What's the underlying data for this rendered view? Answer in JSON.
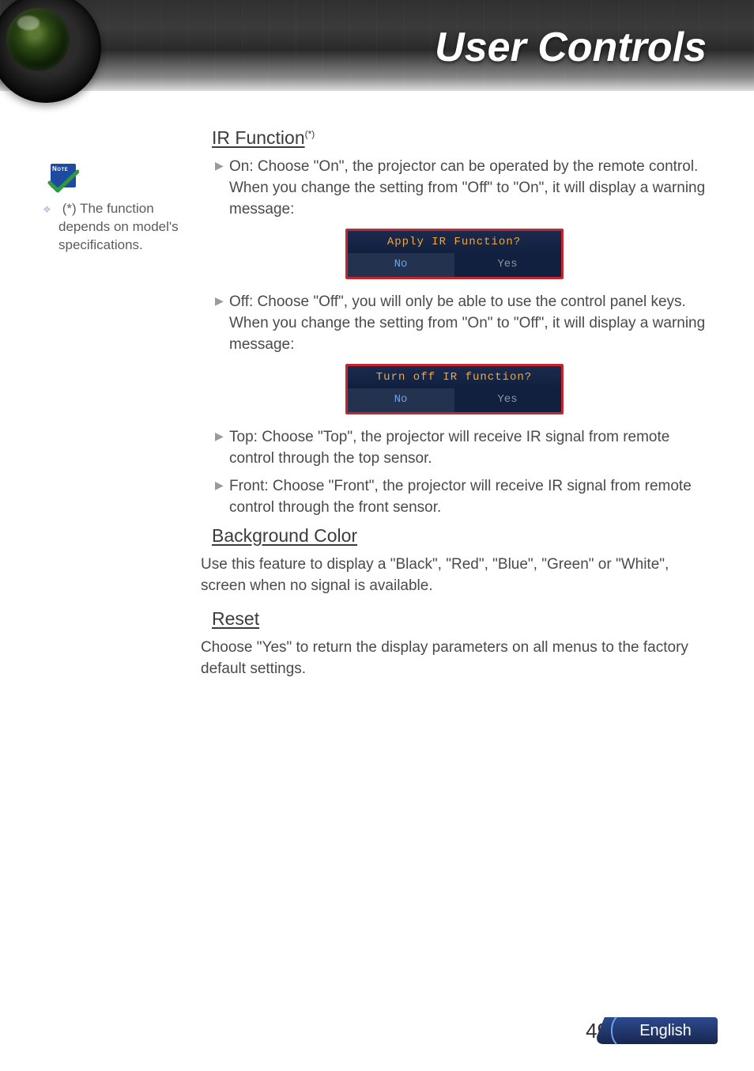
{
  "header": {
    "title": "User Controls"
  },
  "sidebar": {
    "note_badge": "Note",
    "note_text": "(*) The function depends on model's specifications."
  },
  "sections": {
    "ir": {
      "title": "IR Function",
      "title_sup": "(*)",
      "on_text": "On: Choose \"On\", the projector can be operated by the remote control. When you change the setting from \"Off\" to \"On\", it will display a warning message:",
      "dialog_on": {
        "title": "Apply IR Function?",
        "no": "No",
        "yes": "Yes"
      },
      "off_text": "Off: Choose \"Off\", you will only be able to use the control panel keys. When you change the setting from \"On\" to \"Off\", it will display a warning message:",
      "dialog_off": {
        "title": "Turn off IR function?",
        "no": "No",
        "yes": "Yes"
      },
      "top_text": "Top: Choose \"Top\", the projector will receive IR signal from remote control through the top sensor.",
      "front_text": "Front: Choose \"Front\", the projector will receive IR signal from remote control through the front sensor."
    },
    "bg": {
      "title": "Background Color",
      "text": "Use this feature to display a \"Black\", \"Red\", \"Blue\", \"Green\" or \"White\", screen when no signal is available."
    },
    "reset": {
      "title": "Reset",
      "text": "Choose \"Yes\" to return the display parameters on all menus to the factory default settings."
    }
  },
  "footer": {
    "page": "49",
    "language": "English"
  }
}
